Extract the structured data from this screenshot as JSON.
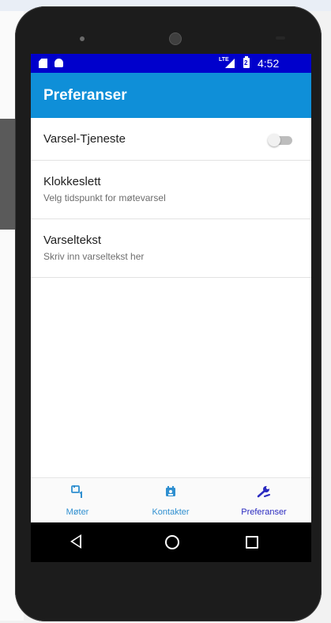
{
  "status_bar": {
    "network": "LTE",
    "battery": "2",
    "time": "4:52"
  },
  "app_bar": {
    "title": "Preferanser"
  },
  "preferences": [
    {
      "title": "Varsel-Tjeneste",
      "subtitle": "",
      "toggle_on": false
    },
    {
      "title": "Klokkeslett",
      "subtitle": "Velg tidspunkt for møtevarsel"
    },
    {
      "title": "Varseltekst",
      "subtitle": "Skriv inn varseltekst her"
    }
  ],
  "bottom_nav": [
    {
      "label": "Møter",
      "icon": "calendar-icon",
      "active": false
    },
    {
      "label": "Kontakter",
      "icon": "contacts-icon",
      "active": false
    },
    {
      "label": "Preferanser",
      "icon": "wrench-icon",
      "active": true
    }
  ],
  "colors": {
    "status_bar": "#0000cc",
    "app_bar": "#0f8fd8",
    "nav_inactive": "#2f8fd0",
    "nav_active": "#2b2bc0"
  }
}
